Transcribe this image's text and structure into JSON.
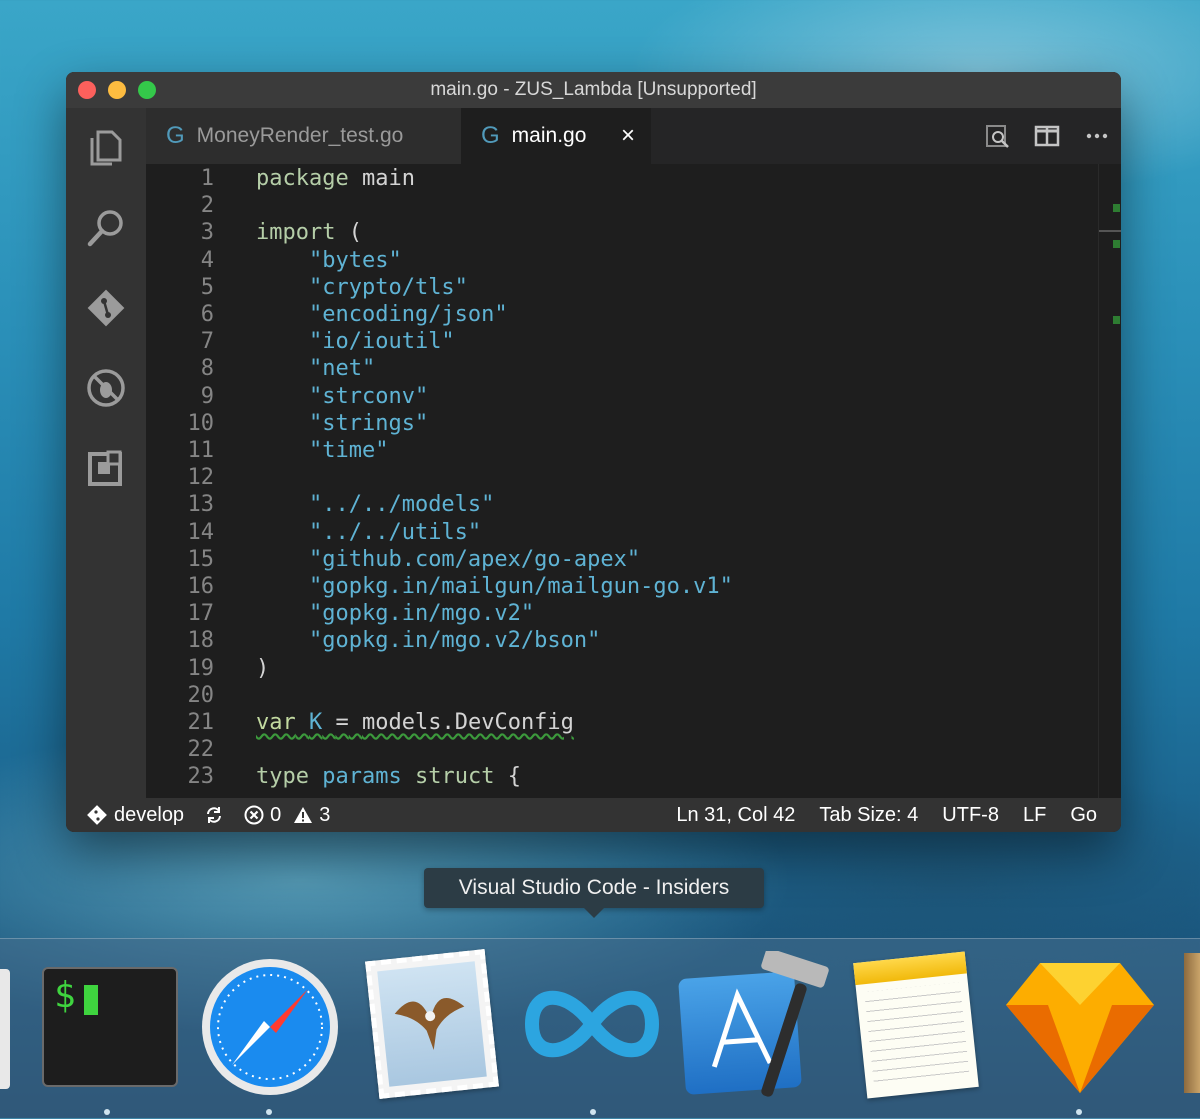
{
  "window": {
    "title": "main.go - ZUS_Lambda [Unsupported]"
  },
  "tabs": [
    {
      "label": "MoneyRender_test.go",
      "icon": "go-file-icon",
      "active": false
    },
    {
      "label": "main.go",
      "icon": "go-file-icon",
      "active": true,
      "close": "×"
    }
  ],
  "activity_icons": [
    "explorer-icon",
    "search-icon",
    "git-icon",
    "debug-icon",
    "extensions-icon"
  ],
  "editor": {
    "lines": [
      {
        "n": "1",
        "html": "<span class='kw'>package</span> <span class='plain'>main</span>"
      },
      {
        "n": "2",
        "html": ""
      },
      {
        "n": "3",
        "html": "<span class='kw'>import</span> <span class='plain'>(</span>"
      },
      {
        "n": "4",
        "html": "    <span class='str'>\"bytes\"</span>"
      },
      {
        "n": "5",
        "html": "    <span class='str'>\"crypto/tls\"</span>"
      },
      {
        "n": "6",
        "html": "    <span class='str'>\"encoding/json\"</span>"
      },
      {
        "n": "7",
        "html": "    <span class='str'>\"io/ioutil\"</span>"
      },
      {
        "n": "8",
        "html": "    <span class='str'>\"net\"</span>"
      },
      {
        "n": "9",
        "html": "    <span class='str'>\"strconv\"</span>"
      },
      {
        "n": "10",
        "html": "    <span class='str'>\"strings\"</span>"
      },
      {
        "n": "11",
        "html": "    <span class='str'>\"time\"</span>"
      },
      {
        "n": "12",
        "html": ""
      },
      {
        "n": "13",
        "html": "    <span class='str'>\"../../models\"</span>"
      },
      {
        "n": "14",
        "html": "    <span class='str'>\"../../utils\"</span>"
      },
      {
        "n": "15",
        "html": "    <span class='str'>\"github.com/apex/go-apex\"</span>"
      },
      {
        "n": "16",
        "html": "    <span class='str'>\"gopkg.in/mailgun/mailgun-go.v1\"</span>"
      },
      {
        "n": "17",
        "html": "    <span class='str'>\"gopkg.in/mgo.v2\"</span>"
      },
      {
        "n": "18",
        "html": "    <span class='str'>\"gopkg.in/mgo.v2/bson\"</span>"
      },
      {
        "n": "19",
        "html": "<span class='plain'>)</span>"
      },
      {
        "n": "20",
        "html": ""
      },
      {
        "n": "21",
        "html": "<span class='squig'><span class='kwv'>var</span> <span class='str'>K</span> <span class='plain'>=</span> <span class='plain'>models.DevConfig</span></span>"
      },
      {
        "n": "22",
        "html": ""
      },
      {
        "n": "23",
        "html": "<span class='kw'>type</span> <span class='str'>params</span> <span class='kw'>struct</span> <span class='plain'>{</span>"
      }
    ]
  },
  "status": {
    "branch": "develop",
    "errors": "0",
    "warnings": "3",
    "position": "Ln 31, Col 42",
    "tab_size": "Tab Size: 4",
    "encoding": "UTF-8",
    "eol": "LF",
    "language": "Go"
  },
  "tooltip": "Visual Studio Code - Insiders",
  "dock": {
    "terminal_prompt": "$",
    "items": [
      "terminal",
      "safari",
      "mail",
      "vscode-insiders",
      "xcode",
      "notes",
      "sketch"
    ]
  }
}
